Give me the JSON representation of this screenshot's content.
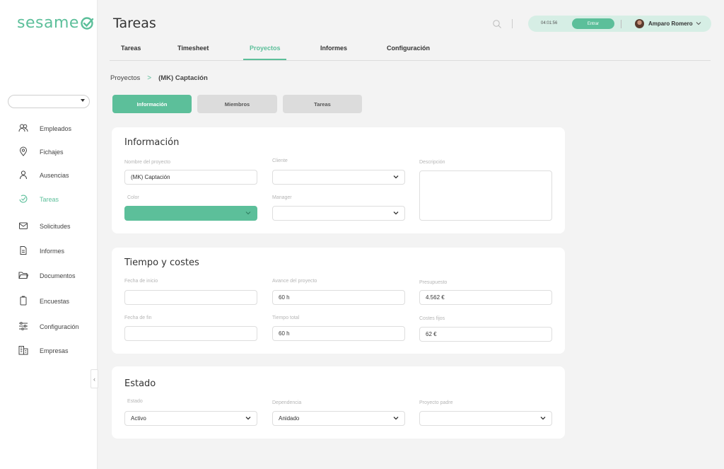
{
  "app": {
    "logo_text": "sesame"
  },
  "sidebar": {
    "items": [
      {
        "label": "Empleados",
        "icon": "people-icon"
      },
      {
        "label": "Fichajes",
        "icon": "location-pin-icon"
      },
      {
        "label": "Ausencias",
        "icon": "person-icon"
      },
      {
        "label": "Tareas",
        "icon": "tasks-icon",
        "active": true
      },
      {
        "label": "Solicitudes",
        "icon": "envelope-icon"
      },
      {
        "label": "Informes",
        "icon": "document-icon"
      },
      {
        "label": "Documentos",
        "icon": "folder-icon"
      },
      {
        "label": "Encuestas",
        "icon": "clipboard-icon"
      },
      {
        "label": "Configuración",
        "icon": "sliders-icon"
      },
      {
        "label": "Empresas",
        "icon": "buildings-icon"
      }
    ]
  },
  "header": {
    "title": "Tareas",
    "clock_time": "04:01:56",
    "entrar_label": "Entrar",
    "user_name": "Amparo Romero"
  },
  "tabs": [
    {
      "label": "Tareas"
    },
    {
      "label": "Timesheet"
    },
    {
      "label": "Proyectos",
      "active": true
    },
    {
      "label": "Informes"
    },
    {
      "label": "Configuración"
    }
  ],
  "breadcrumb": {
    "root": "Proyectos",
    "separator": ">",
    "current": "(MK) Captación"
  },
  "segments": [
    {
      "label": "Información",
      "active": true
    },
    {
      "label": "Miembros"
    },
    {
      "label": "Tareas"
    }
  ],
  "info_card": {
    "title": "Información",
    "project_name_label": "Nombre del proyecto",
    "project_name_value": "(MK) Captación",
    "client_label": "Cliente",
    "client_value": "",
    "description_label": "Descripción",
    "color_label": "Color",
    "manager_label": "Manager",
    "manager_value": ""
  },
  "time_card": {
    "title": "Tiempo y costes",
    "start_date_label": "Fecha de inicio",
    "start_date_value": "",
    "progress_label": "Avance del proyecto",
    "progress_value": "60 h",
    "budget_label": "Presupuesto",
    "budget_value": "4.562 €",
    "end_date_label": "Fecha de fin",
    "end_date_value": "",
    "total_time_label": "Tiempo total",
    "total_time_value": "60 h",
    "fixed_costs_label": "Costes fijos",
    "fixed_costs_value": "62 €"
  },
  "status_card": {
    "title": "Estado",
    "status_label": "Estado",
    "status_value": "Activo",
    "dependency_label": "Dependencia",
    "dependency_value": "Anidado",
    "parent_label": "Proyecto padre",
    "parent_value": ""
  },
  "colors": {
    "accent": "#5cbf9a",
    "accent_light": "#d6eee5",
    "background": "#f3f3f3"
  }
}
